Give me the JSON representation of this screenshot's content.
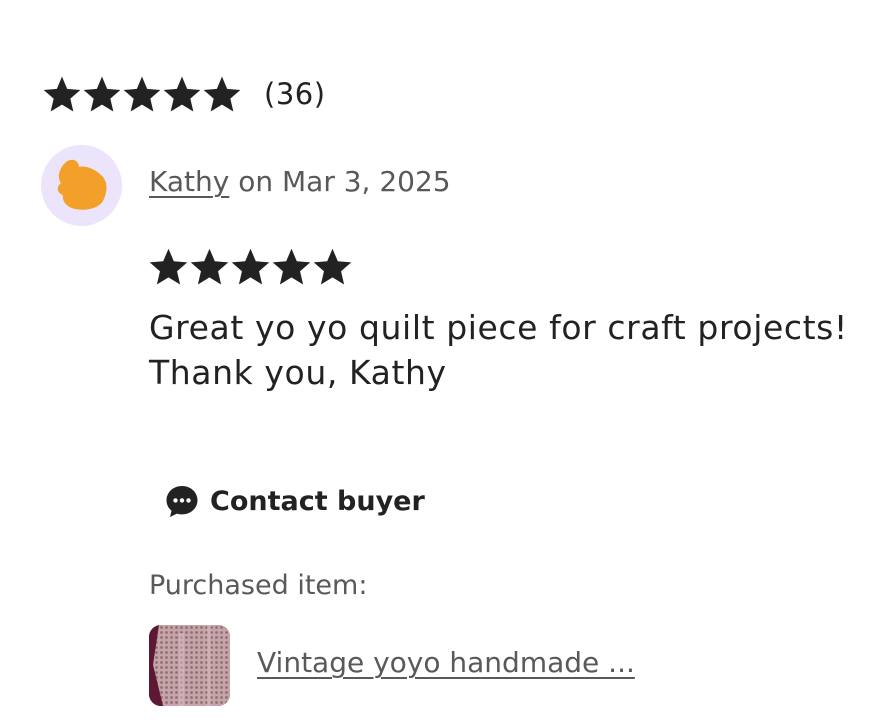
{
  "summary": {
    "rating_stars": 5,
    "review_count": "(36)"
  },
  "review": {
    "reviewer_name": "Kathy",
    "date_text": " on Mar 3, 2025",
    "rating_stars": 5,
    "text_lines": [
      "Great yo yo quilt piece for craft projects!",
      "Thank you, Kathy"
    ],
    "avatar_icon": "orange-blob-avatar"
  },
  "actions": {
    "contact_label": "Contact buyer",
    "contact_icon": "chat-bubble-icon"
  },
  "purchase": {
    "label": "Purchased item:",
    "item_title": "Vintage yoyo handmade ...",
    "thumbnail_icon": "quilt-thumbnail"
  },
  "colors": {
    "star": "#222222",
    "avatar_bg": "#ece4fb",
    "avatar_blob": "#f2a02a",
    "muted_text": "#595959"
  }
}
